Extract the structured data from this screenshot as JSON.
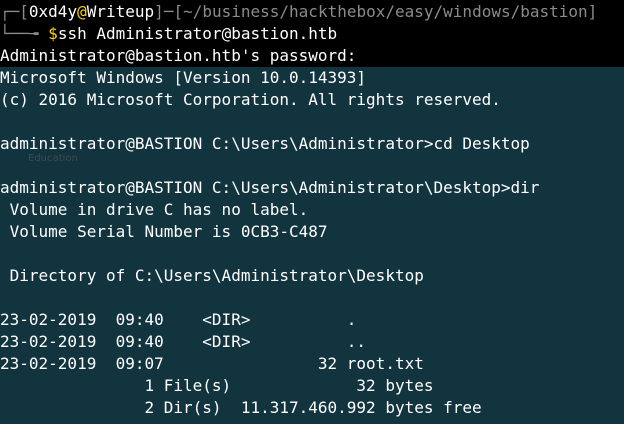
{
  "prompt": {
    "frame_top": "┌─",
    "frame_bottom": "└──╼ ",
    "bracket_open": "[",
    "bracket_close": "]",
    "user": "0xd4y",
    "at": "@",
    "host": "Writeup",
    "sep": "─",
    "path_open": "[",
    "path": "~/business/hackthebox/easy/windows/bastion",
    "path_close": "]",
    "dollar": "$",
    "command": "ssh Administrator@bastion.htb"
  },
  "output": {
    "password_prompt": "Administrator@bastion.htb's password:",
    "win_version": "Microsoft Windows [Version 10.0.14393]",
    "copyright": "(c) 2016 Microsoft Corporation. All rights reserved.",
    "cmd1": "administrator@BASTION C:\\Users\\Administrator>cd Desktop",
    "cmd2": "administrator@BASTION C:\\Users\\Administrator\\Desktop>dir",
    "volume_label": " Volume in drive C has no label.",
    "volume_serial": " Volume Serial Number is 0CB3-C487",
    "directory_of": " Directory of C:\\Users\\Administrator\\Desktop",
    "dir_rows": [
      "23-02-2019  09:40    <DIR>          .",
      "23-02-2019  09:40    <DIR>          ..",
      "23-02-2019  09:07                32 root.txt"
    ],
    "summary_files": "               1 File(s)             32 bytes",
    "summary_dirs": "               2 Dir(s)  11.317.460.992 bytes free"
  },
  "ghost_text": "Education",
  "colors": {
    "background": "#000000",
    "highlight": "#12343f",
    "accent": "#ffd400",
    "muted": "#8b8b8b"
  }
}
